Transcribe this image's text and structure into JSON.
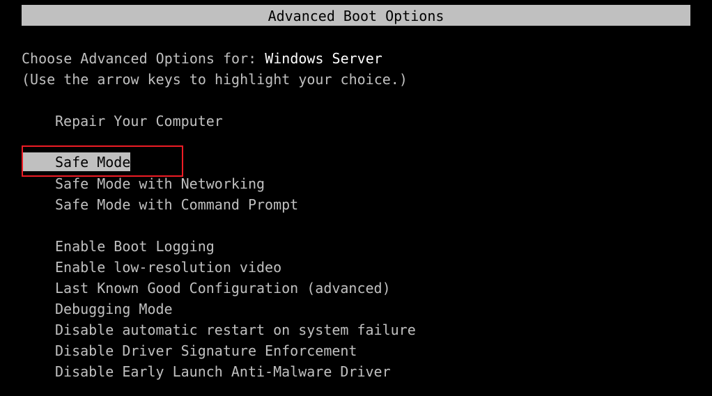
{
  "header": {
    "title": "Advanced Boot Options"
  },
  "prompt": {
    "prefix": "Choose Advanced Options for: ",
    "os_name": "Windows Server",
    "hint": "(Use the arrow keys to highlight your choice.)"
  },
  "options": [
    {
      "label": "Repair Your Computer"
    },
    {
      "label": "Safe Mode",
      "selected": true
    },
    {
      "label": "Safe Mode with Networking"
    },
    {
      "label": "Safe Mode with Command Prompt"
    },
    {
      "label": "Enable Boot Logging"
    },
    {
      "label": "Enable low-resolution video"
    },
    {
      "label": "Last Known Good Configuration (advanced)"
    },
    {
      "label": "Debugging Mode"
    },
    {
      "label": "Disable automatic restart on system failure"
    },
    {
      "label": "Disable Driver Signature Enforcement"
    },
    {
      "label": "Disable Early Launch Anti-Malware Driver"
    }
  ],
  "colors": {
    "highlight_annotation": "#ee1c25",
    "selection_bg": "#c0c0c0",
    "text": "#c0c0c0"
  }
}
